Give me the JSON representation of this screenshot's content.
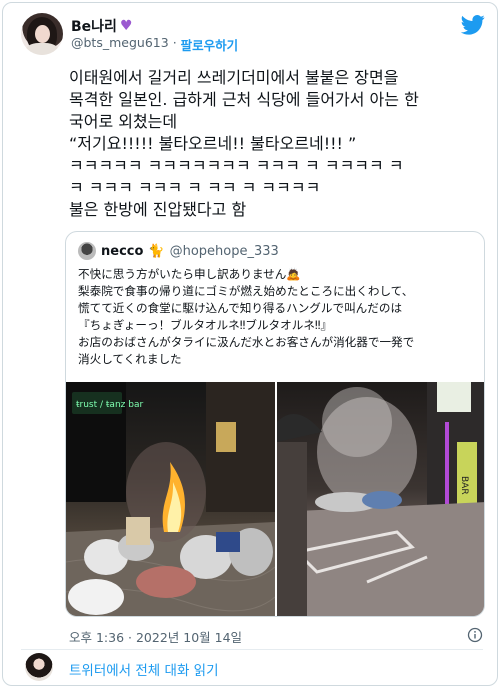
{
  "header": {
    "display_name": "Be나리",
    "handle": "@bts_megu613",
    "separator": "·",
    "follow_label": "팔로우하기",
    "heart_icon": "purple-heart-icon",
    "brand_icon": "twitter-bird-icon",
    "brand_color": "#1d9bf0"
  },
  "tweet": {
    "lines": [
      "이태원에서 길거리 쓰레기더미에서 불붙은 장면을",
      "목격한 일본인. 급하게 근처 식당에 들어가서 아는 한",
      "국어로 외쳤는데",
      "“저기요!!!!! 불타오르네!! 불타오르네!!! ”",
      "ㅋㅋㅋㅋㅋ ㅋㅋㅋㅋㅋㅋㅋ ㅋㅋㅋ ㅋ ㅋㅋㅋㅋ ㅋ",
      "ㅋ ㅋㅋㅋ ㅋㅋㅋ ㅋ ㅋㅋ ㅋ ㅋㅋㅋㅋ",
      "불은 한방에 진압됐다고 함"
    ],
    "timestamp": "오후 1:36 · 2022년 10월 14일"
  },
  "quote": {
    "name": "necco",
    "name_icon": "cat-emoji-icon",
    "handle": "@hopehope_333",
    "lines": [
      "不快に思う方がいたら申し訳ありません🙇",
      "梨泰院で食事の帰り道にゴミが燃え始めたところに出くわして、",
      "慌てて近くの食堂に駆け込んで知り得るハングルで叫んだのは",
      "『ちょぎょーっ！ブルタオルネ‼ブルタオルネ‼』",
      "お店のおばさんがタライに汲んだ水とお客さんが消化器で一発で",
      "消火してくれました"
    ],
    "photo_left_sign": "ŧrust / ŧanz bar",
    "photo_right_sign": "BAR"
  },
  "footer": {
    "link_label": "트위터에서 전체 대화 읽기",
    "info_icon": "info-icon"
  }
}
